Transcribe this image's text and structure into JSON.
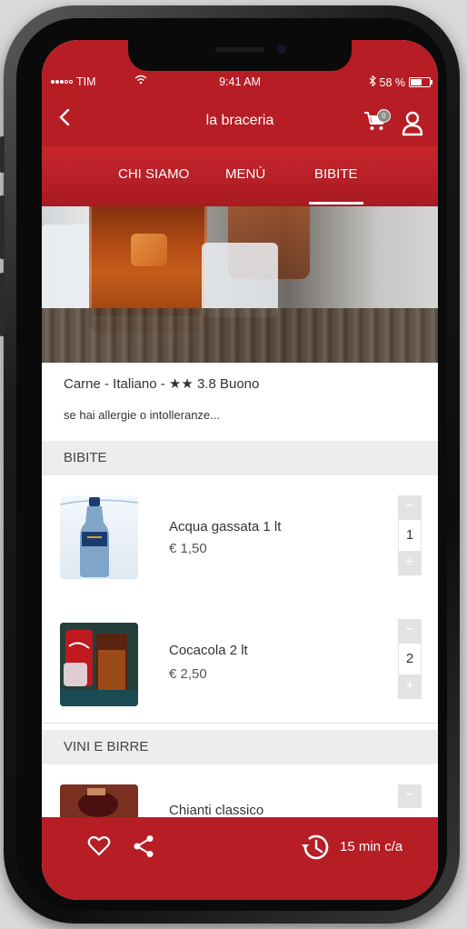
{
  "status_bar": {
    "carrier": "TIM",
    "time": "9:41 AM",
    "battery": "58 %",
    "battery_level": 0.58
  },
  "header": {
    "back_label": "<",
    "title": "la braceria",
    "cart_count": "0"
  },
  "tabs": [
    {
      "label": "CHI SIAMO",
      "active": false
    },
    {
      "label": "MENÙ",
      "active": false
    },
    {
      "label": "BIBITE",
      "active": true
    }
  ],
  "restaurant": {
    "cuisine": "Carne - Italiano - ★★ 3.8 Buono",
    "allergy_note": "se hai allergie o intolleranze..."
  },
  "sections": [
    {
      "title": "BIBITE",
      "items": [
        {
          "name": "Acqua gassata 1 lt",
          "price": "€ 1,50",
          "qty": "1",
          "minus": "−",
          "plus": "+"
        },
        {
          "name": "Cocacola 2 lt",
          "price": "€ 2,50",
          "qty": "2",
          "minus": "−",
          "plus": "+"
        }
      ]
    },
    {
      "title": "VINI E BIRRE",
      "items": [
        {
          "name": "Chianti classico",
          "minus": "−"
        }
      ]
    }
  ],
  "bottom_bar": {
    "eta": "15 min c/a"
  },
  "colors": {
    "brand_red": "#b71d24",
    "section_bg": "#ededed"
  },
  "icons": [
    "back-icon",
    "cart-icon",
    "user-icon",
    "heart-icon",
    "share-icon",
    "history-icon"
  ]
}
